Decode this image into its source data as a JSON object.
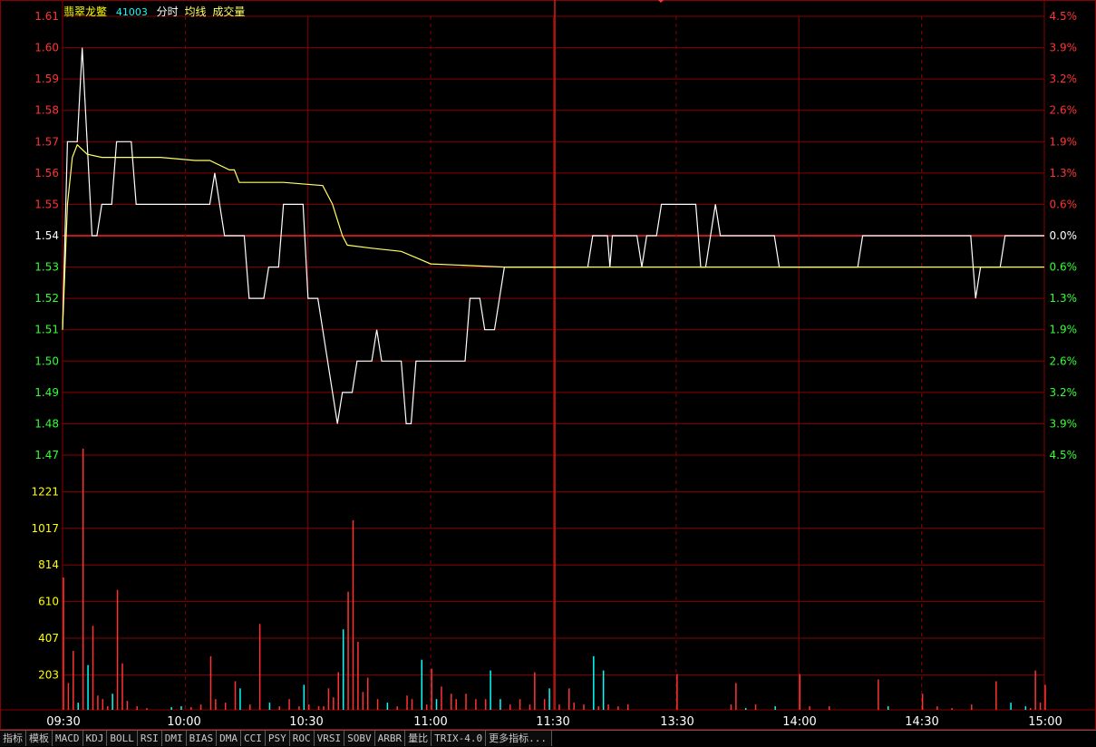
{
  "header": {
    "stock_name": "翡翠龙鳖",
    "stock_code": "41003",
    "mode": "分时",
    "avg_label": "均线",
    "vol_label": "成交量"
  },
  "colors": {
    "background": "#000000",
    "grid": "#8b0000",
    "price_line": "#ffffff",
    "avg_line": "#ffff66",
    "up": "#ff3333",
    "down": "#33ff33",
    "flat": "#ffffff",
    "volume_up": "#ff3333",
    "volume_down": "#00ffff",
    "volume_label": "#ffff00",
    "header_name": "#ffff00",
    "header_code": "#00ffff"
  },
  "tabs": [
    "指标",
    "模板",
    "MACD",
    "KDJ",
    "BOLL",
    "RSI",
    "DMI",
    "BIAS",
    "DMA",
    "CCI",
    "PSY",
    "ROC",
    "VRSI",
    "SOBV",
    "ARBR",
    "量比",
    "TRIX-4.0",
    "更多指标..."
  ],
  "chart_data": {
    "type": "line",
    "x_ticks": [
      "09:30",
      "10:00",
      "10:30",
      "11:00",
      "11:30",
      "13:30",
      "14:00",
      "14:30",
      "15:00"
    ],
    "price_axis": {
      "labels": [
        "1.61",
        "1.60",
        "1.59",
        "1.58",
        "1.57",
        "1.56",
        "1.55",
        "1.54",
        "1.53",
        "1.52",
        "1.51",
        "1.50",
        "1.49",
        "1.48",
        "1.47"
      ],
      "ylim": [
        1.47,
        1.61
      ],
      "prev_close": 1.54
    },
    "percent_axis": {
      "labels": [
        "4.5%",
        "3.9%",
        "3.2%",
        "2.6%",
        "1.9%",
        "1.3%",
        "0.6%",
        "0.0%",
        "0.6%",
        "1.3%",
        "1.9%",
        "2.6%",
        "3.2%",
        "3.9%",
        "4.5%"
      ]
    },
    "volume_axis": {
      "labels": [
        "1221",
        "1017",
        "814",
        "610",
        "407",
        "203"
      ],
      "ylim": [
        0,
        1424
      ]
    },
    "series": [
      {
        "key": "price",
        "points": [
          [
            0,
            1.51
          ],
          [
            1,
            1.57
          ],
          [
            3,
            1.57
          ],
          [
            4,
            1.6
          ],
          [
            6,
            1.54
          ],
          [
            7,
            1.54
          ],
          [
            8,
            1.55
          ],
          [
            10,
            1.55
          ],
          [
            11,
            1.57
          ],
          [
            14,
            1.57
          ],
          [
            15,
            1.55
          ],
          [
            30,
            1.55
          ],
          [
            31,
            1.56
          ],
          [
            33,
            1.54
          ],
          [
            37,
            1.54
          ],
          [
            38,
            1.52
          ],
          [
            41,
            1.52
          ],
          [
            42,
            1.53
          ],
          [
            44,
            1.53
          ],
          [
            45,
            1.55
          ],
          [
            49,
            1.55
          ],
          [
            50,
            1.52
          ],
          [
            52,
            1.52
          ],
          [
            55,
            1.49
          ],
          [
            56,
            1.48
          ],
          [
            57,
            1.49
          ],
          [
            59,
            1.49
          ],
          [
            60,
            1.5
          ],
          [
            63,
            1.5
          ],
          [
            64,
            1.51
          ],
          [
            65,
            1.5
          ],
          [
            69,
            1.5
          ],
          [
            70,
            1.48
          ],
          [
            71,
            1.48
          ],
          [
            72,
            1.5
          ],
          [
            82,
            1.5
          ],
          [
            83,
            1.52
          ],
          [
            85,
            1.52
          ],
          [
            86,
            1.51
          ],
          [
            88,
            1.51
          ],
          [
            90,
            1.53
          ],
          [
            107,
            1.53
          ],
          [
            108,
            1.54
          ],
          [
            111,
            1.54
          ],
          [
            111.5,
            1.53
          ],
          [
            112,
            1.54
          ],
          [
            117,
            1.54
          ],
          [
            118,
            1.53
          ],
          [
            119,
            1.54
          ],
          [
            121,
            1.54
          ],
          [
            122,
            1.55
          ],
          [
            129,
            1.55
          ],
          [
            130,
            1.53
          ],
          [
            131,
            1.53
          ],
          [
            133,
            1.55
          ],
          [
            134,
            1.54
          ],
          [
            145,
            1.54
          ],
          [
            146,
            1.53
          ],
          [
            162,
            1.53
          ],
          [
            163,
            1.54
          ],
          [
            185,
            1.54
          ],
          [
            186,
            1.52
          ],
          [
            187,
            1.53
          ],
          [
            191,
            1.53
          ],
          [
            192,
            1.54
          ],
          [
            200,
            1.54
          ]
        ]
      },
      {
        "key": "average",
        "points": [
          [
            0,
            1.51
          ],
          [
            1,
            1.55
          ],
          [
            2,
            1.565
          ],
          [
            3,
            1.569
          ],
          [
            5,
            1.566
          ],
          [
            8,
            1.565
          ],
          [
            20,
            1.565
          ],
          [
            27,
            1.564
          ],
          [
            30,
            1.564
          ],
          [
            34,
            1.561
          ],
          [
            35,
            1.561
          ],
          [
            36,
            1.557
          ],
          [
            45,
            1.557
          ],
          [
            53,
            1.556
          ],
          [
            55,
            1.55
          ],
          [
            57,
            1.54
          ],
          [
            58,
            1.537
          ],
          [
            63,
            1.536
          ],
          [
            69,
            1.535
          ],
          [
            72,
            1.533
          ],
          [
            75,
            1.531
          ],
          [
            90,
            1.53
          ],
          [
            200,
            1.53
          ]
        ]
      }
    ],
    "volume": [
      [
        0,
        740
      ],
      [
        1,
        150
      ],
      [
        2,
        330
      ],
      [
        3,
        40
      ],
      [
        4,
        1460
      ],
      [
        5,
        250
      ],
      [
        6,
        470
      ],
      [
        7,
        80
      ],
      [
        8,
        60
      ],
      [
        9,
        20
      ],
      [
        10,
        90
      ],
      [
        11,
        670
      ],
      [
        12,
        260
      ],
      [
        13,
        50
      ],
      [
        15,
        20
      ],
      [
        17,
        10
      ],
      [
        22,
        15
      ],
      [
        24,
        20
      ],
      [
        26,
        15
      ],
      [
        28,
        30
      ],
      [
        30,
        300
      ],
      [
        31,
        60
      ],
      [
        33,
        40
      ],
      [
        35,
        160
      ],
      [
        36,
        120
      ],
      [
        38,
        30
      ],
      [
        40,
        480
      ],
      [
        42,
        40
      ],
      [
        44,
        20
      ],
      [
        46,
        60
      ],
      [
        48,
        20
      ],
      [
        49,
        140
      ],
      [
        50,
        30
      ],
      [
        52,
        20
      ],
      [
        53,
        20
      ],
      [
        54,
        120
      ],
      [
        55,
        70
      ],
      [
        56,
        210
      ],
      [
        57,
        450
      ],
      [
        58,
        660
      ],
      [
        59,
        1060
      ],
      [
        60,
        380
      ],
      [
        61,
        100
      ],
      [
        62,
        180
      ],
      [
        64,
        60
      ],
      [
        66,
        40
      ],
      [
        68,
        20
      ],
      [
        70,
        80
      ],
      [
        71,
        60
      ],
      [
        73,
        280
      ],
      [
        74,
        30
      ],
      [
        75,
        230
      ],
      [
        76,
        60
      ],
      [
        77,
        130
      ],
      [
        79,
        90
      ],
      [
        80,
        60
      ],
      [
        82,
        90
      ],
      [
        84,
        60
      ],
      [
        86,
        60
      ],
      [
        87,
        220
      ],
      [
        89,
        60
      ],
      [
        91,
        30
      ],
      [
        93,
        60
      ],
      [
        95,
        30
      ],
      [
        96,
        210
      ],
      [
        98,
        60
      ],
      [
        99,
        120
      ],
      [
        101,
        30
      ],
      [
        103,
        120
      ],
      [
        104,
        40
      ],
      [
        106,
        30
      ],
      [
        108,
        300
      ],
      [
        109,
        20
      ],
      [
        110,
        220
      ],
      [
        111,
        30
      ],
      [
        113,
        20
      ],
      [
        115,
        30
      ],
      [
        125,
        200
      ],
      [
        136,
        30
      ],
      [
        137,
        150
      ],
      [
        139,
        10
      ],
      [
        141,
        30
      ],
      [
        145,
        20
      ],
      [
        150,
        200
      ],
      [
        152,
        20
      ],
      [
        156,
        20
      ],
      [
        166,
        170
      ],
      [
        168,
        20
      ],
      [
        175,
        90
      ],
      [
        178,
        20
      ],
      [
        181,
        10
      ],
      [
        185,
        30
      ],
      [
        190,
        160
      ],
      [
        193,
        40
      ],
      [
        196,
        20
      ],
      [
        197,
        10
      ],
      [
        198,
        220
      ],
      [
        199,
        40
      ],
      [
        200,
        140
      ]
    ]
  }
}
